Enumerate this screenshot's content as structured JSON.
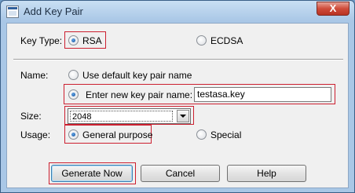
{
  "window": {
    "title": "Add Key Pair",
    "close_label": "X"
  },
  "key_type": {
    "label": "Key Type:",
    "options": [
      {
        "label": "RSA",
        "selected": true
      },
      {
        "label": "ECDSA",
        "selected": false
      }
    ]
  },
  "name": {
    "label": "Name:",
    "default_option": {
      "label": "Use default key pair name",
      "selected": false
    },
    "new_option": {
      "label": "Enter new key pair name:",
      "selected": true
    },
    "value": "testasa.key"
  },
  "size": {
    "label": "Size:",
    "value": "2048"
  },
  "usage": {
    "label": "Usage:",
    "options": [
      {
        "label": "General purpose",
        "selected": true
      },
      {
        "label": "Special",
        "selected": false
      }
    ]
  },
  "buttons": {
    "generate": "Generate Now",
    "cancel": "Cancel",
    "help": "Help"
  },
  "colors": {
    "highlight": "#cc1f2f",
    "title_bar": "#a9c7e6",
    "client_bg": "#f0f0f0"
  }
}
